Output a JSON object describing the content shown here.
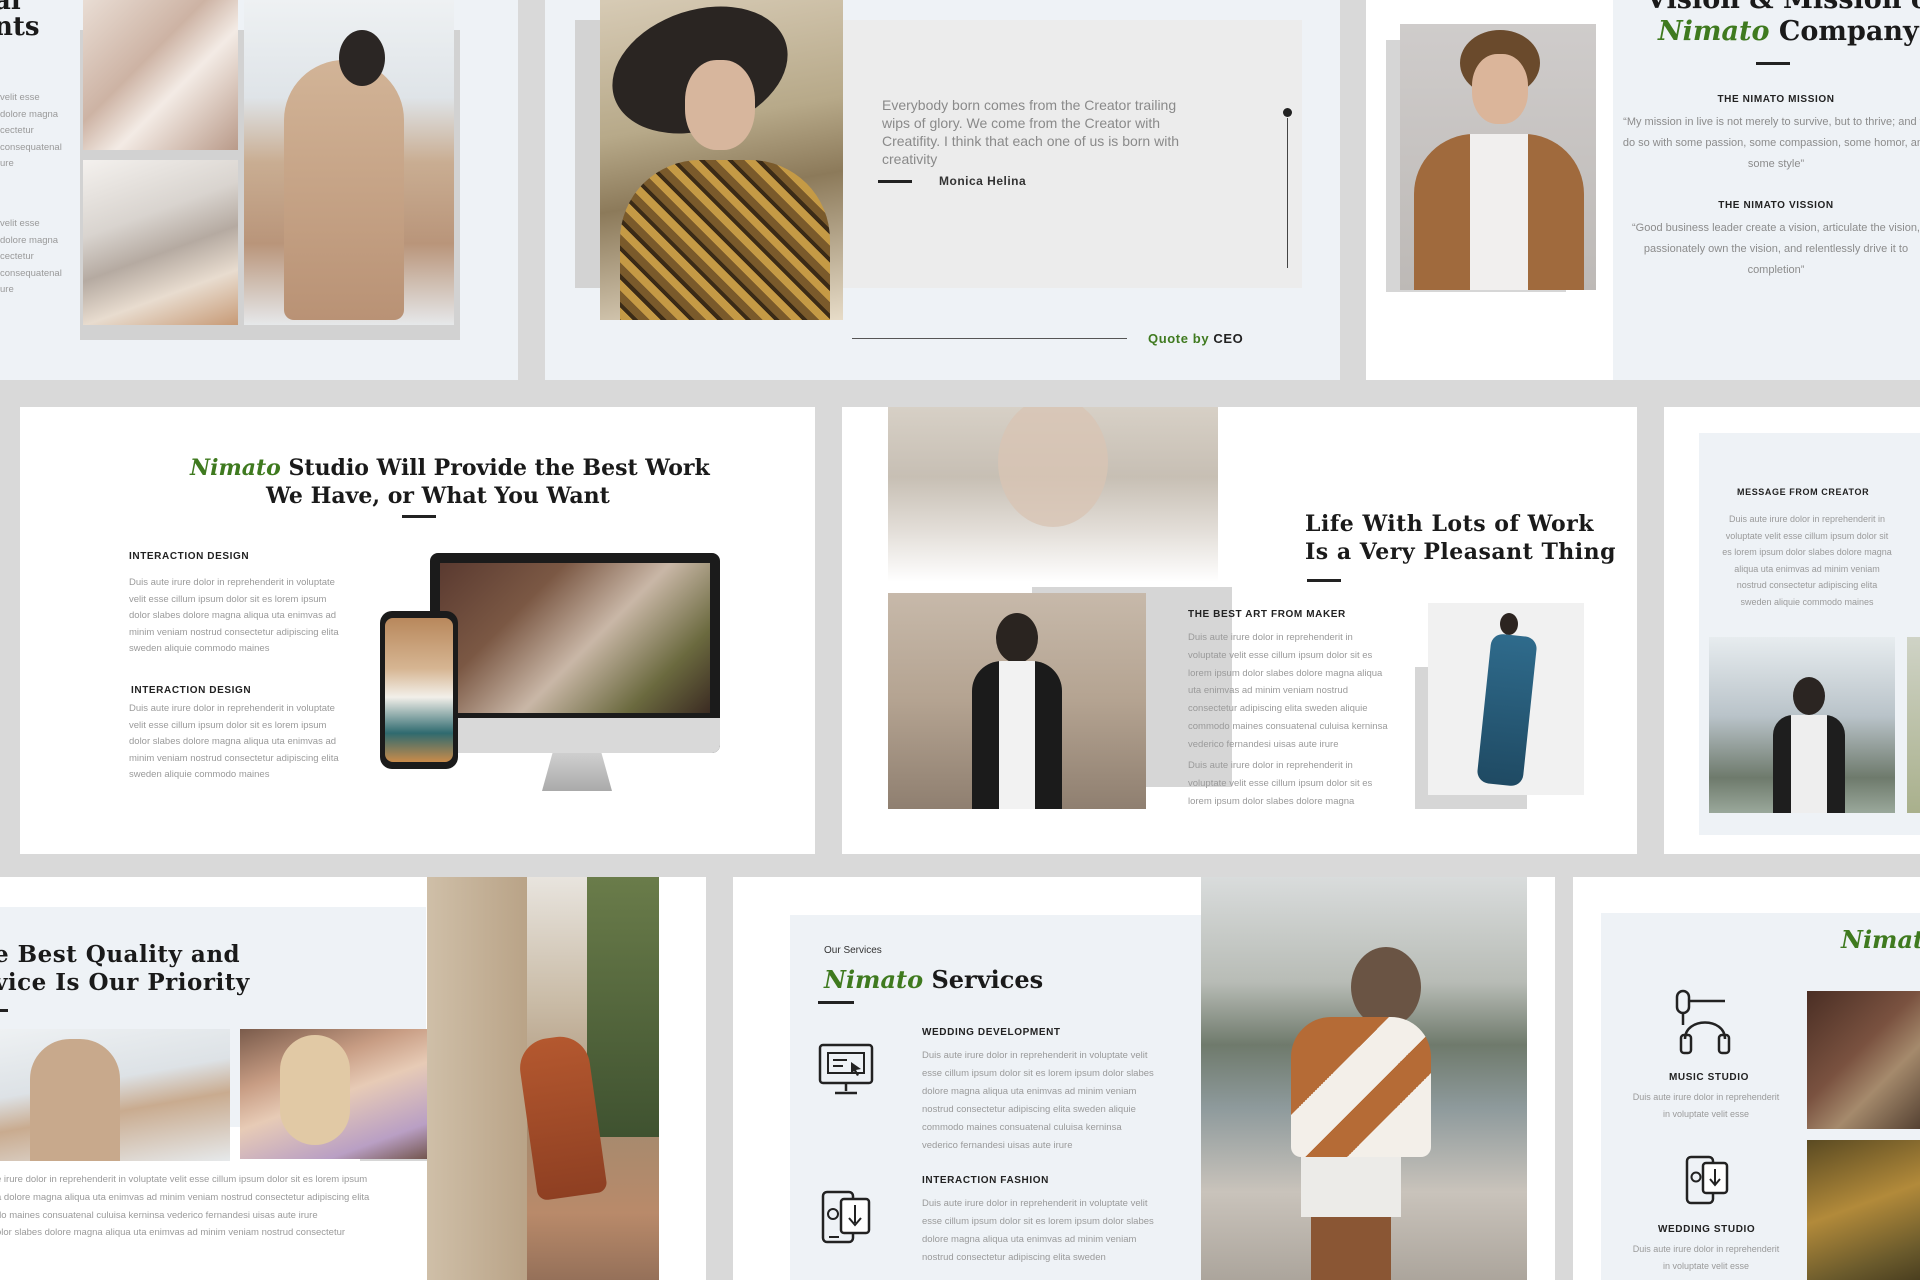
{
  "slide1": {
    "title_line1": "al",
    "title_line2": "nts",
    "body1": "velit esse\ndolore magna\ncectetur\nconsequatenal\nure",
    "body2": "velit esse\ndolore magna\ncectetur\nconsequatenal\nure"
  },
  "slide2": {
    "quote": "Everybody born comes from the Creator trailing wips of glory. We come from the Creator with Creatifity. I think that each one of us is born with creativity",
    "author": "Monica Helina",
    "footer_word1": "Quote",
    "footer_word2": "by",
    "footer_word3": "CEO"
  },
  "slide3": {
    "title_line1": "Vision & Mission of",
    "brand": "Nimato",
    "title_company": "Company",
    "mission_label": "THE NIMATO MISSION",
    "mission_text": "“My mission in live is not merely to survive, but to thrive; and to do so with some passion, some compassion, some homor, and some style”",
    "vision_label": "THE NIMATO VISSION",
    "vision_text": "“Good business leader create a vision, articulate the vision, passionately own the vision, and relentlessly drive it to completion”"
  },
  "slide4": {
    "brand": "Nimato",
    "title_rest": "Studio Will Provide the Best Work",
    "title_line2": "We Have, or What You Want",
    "label1": "INTERACTION DESIGN",
    "body1": "Duis aute irure dolor in reprehenderit in voluptate velit esse cillum ipsum dolor sit es lorem ipsum dolor slabes dolore magna aliqua uta enimvas ad minim veniam nostrud consectetur adipiscing elita sweden aliquie commodo maines",
    "label2": "INTERACTION DESIGN",
    "body2": "Duis aute irure dolor in reprehenderit in voluptate velit esse cillum ipsum dolor sit es lorem ipsum dolor slabes dolore magna aliqua uta enimvas ad minim veniam nostrud consectetur adipiscing elita sweden aliquie commodo maines"
  },
  "slide5": {
    "title_line1": "Life With Lots of Work",
    "title_line2": "Is a Very Pleasant Thing",
    "label": "THE BEST ART FROM MAKER",
    "body1": "Duis aute irure dolor in reprehenderit in voluptate velit esse cillum ipsum dolor sit es lorem ipsum dolor slabes dolore magna aliqua uta enimvas ad minim veniam nostrud consectetur adipiscing elita sweden aliquie commodo maines consuatenal culuisa kerninsa vederico fernandesi uisas aute irure",
    "body2": "Duis aute irure dolor in reprehenderit in voluptate velit esse cillum ipsum dolor sit es lorem ipsum dolor slabes dolore magna"
  },
  "slide6": {
    "label": "MESSAGE FROM CREATOR",
    "body": "Duis aute irure dolor in reprehenderit in voluptate velit esse cillum ipsum dolor sit es lorem ipsum dolor slabes dolore magna aliqua uta enimvas ad minim veniam nostrud consectetur adipiscing elita sweden aliquie commodo maines"
  },
  "slide7": {
    "title_line1": "e Best Quality and",
    "title_line2": "vice Is Our Priority",
    "body": "e irure dolor in reprehenderit in voluptate velit esse cillum ipsum dolor sit es lorem ipsum\na dolore magna aliqua uta enimvas ad minim veniam nostrud consectetur adipiscing elita\ndo maines consuatenal culuisa kerninsa vederico fernandesi uisas aute irure\nolor slabes dolore magna aliqua uta enimvas ad minim veniam nostrud consectetur"
  },
  "slide8": {
    "kicker": "Our Services",
    "brand": "Nimato",
    "title_rest": "Services",
    "label1": "WEDDING DEVELOPMENT",
    "body1": "Duis aute irure dolor in reprehenderit in voluptate velit esse cillum ipsum dolor sit es lorem ipsum dolor slabes dolore magna aliqua uta enimvas ad minim veniam nostrud consectetur adipiscing elita sweden aliquie commodo maines consuatenal culuisa kerninsa vederico fernandesi uisas aute irure",
    "label2": "INTERACTION FASHION",
    "body2": "Duis aute irure dolor in reprehenderit in voluptate velit esse cillum ipsum dolor sit es lorem ipsum dolor slabes dolore magna aliqua uta enimvas ad minim veniam nostrud consectetur adipiscing elita sweden"
  },
  "slide9": {
    "brand": "Nimat",
    "label1": "MUSIC STUDIO",
    "body1": "Duis aute irure dolor in reprehenderit in voluptate velit esse",
    "label2": "WEDDING STUDIO",
    "body2": "Duis aute irure dolor in reprehenderit in voluptate velit esse"
  },
  "colors": {
    "accent_green": "#3f7a1f",
    "panel": "#eef2f6",
    "background": "#d9d9d9"
  }
}
